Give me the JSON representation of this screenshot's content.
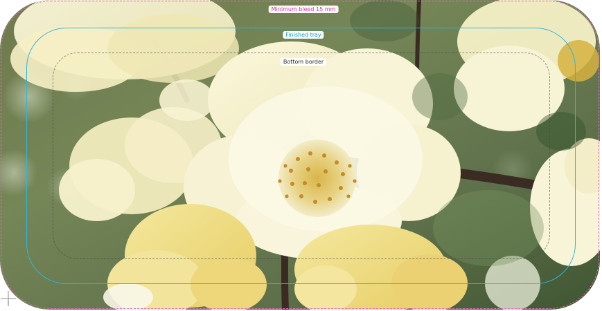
{
  "labels": {
    "bleed": "Minimum bleed 15 mm",
    "tray": "Finished tray",
    "border": "Bottom border"
  },
  "colors": {
    "bleed": "#e36ac3",
    "tray": "#2eb6df",
    "border": "#444444"
  },
  "icons": {
    "crosshair": "crosshair-icon"
  }
}
